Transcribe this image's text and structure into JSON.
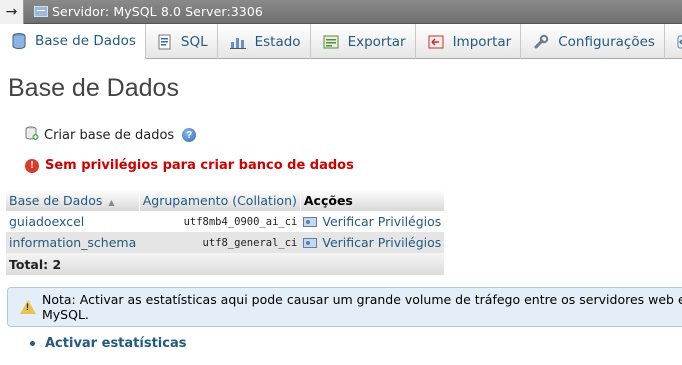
{
  "topbar": {
    "back_label": "→",
    "server_label": "Servidor: MySQL 8.0 Server:3306"
  },
  "tabs": [
    {
      "label": "Base de Dados",
      "icon": "database-icon",
      "active": true
    },
    {
      "label": "SQL",
      "icon": "sql-icon"
    },
    {
      "label": "Estado",
      "icon": "status-chart-icon"
    },
    {
      "label": "Exportar",
      "icon": "export-icon"
    },
    {
      "label": "Importar",
      "icon": "import-icon"
    },
    {
      "label": "Configurações",
      "icon": "wrench-icon"
    },
    {
      "label": "",
      "icon": "replication-icon"
    }
  ],
  "page": {
    "title": "Base de Dados",
    "create_label": "Criar base de dados",
    "help_glyph": "?",
    "error_glyph": "!",
    "error_text": "Sem privilégios para criar banco de dados"
  },
  "table": {
    "headers": {
      "name": "Base de Dados",
      "collation": "Agrupamento (Collation)",
      "actions": "Acções"
    },
    "rows": [
      {
        "name": "guiadoexcel",
        "collation": "utf8mb4_0900_ai_ci",
        "action": "Verificar Privilégios"
      },
      {
        "name": "information_schema",
        "collation": "utf8_general_ci",
        "action": "Verificar Privilégios"
      }
    ],
    "total": "Total: 2"
  },
  "notice": {
    "warn_glyph": "!",
    "text": "Nota: Activar as estatísticas aqui pode causar um grande volume de tráfego entre os servidores web e MySQL."
  },
  "stats_link": "Activar estatísticas",
  "colors": {
    "link": "#235a81",
    "error": "#d00000",
    "notice_bg": "#e3eef8"
  }
}
